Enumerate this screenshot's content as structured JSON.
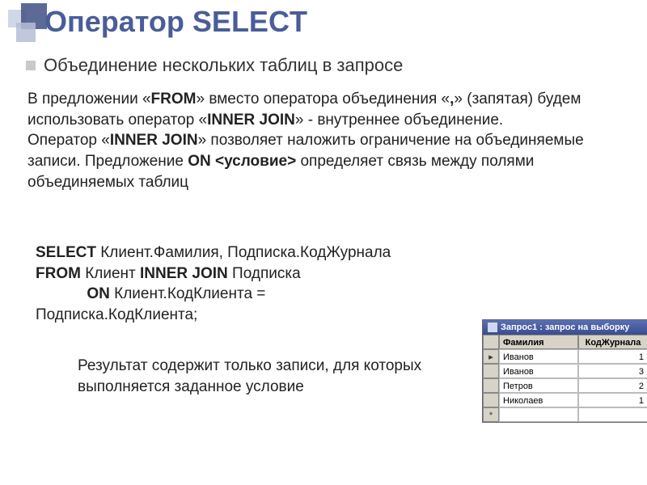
{
  "title": "Оператор SELECT",
  "subtitle": "Объединение нескольких таблиц в запросе",
  "para": {
    "p1a": "В предложении «",
    "from": "FROM",
    "p1b": "» вместо оператора объединения «",
    "comma": ",",
    "p1c": "» (запятая) будем использовать оператор «",
    "ij1": "INNER JOIN",
    "p1d": "» - внутреннее объединение.",
    "p2a": "Оператор «",
    "ij2": "INNER JOIN",
    "p2b": "» позволяет наложить ограничение на объединяемые записи. Предложение ",
    "on": "ON <условие>",
    "p2c": " определяет связь между полями объединяемых таблиц"
  },
  "sql": {
    "kw_select": "SELECT",
    "sel_fields": " Клиент.Фамилия, Подписка.КодЖурнала",
    "kw_from": "FROM",
    "tbl1": " Клиент ",
    "kw_ij": "INNER JOIN",
    "tbl2": " Подписка",
    "on_indent": "            ",
    "kw_on": "ON",
    "on_expr1": " Клиент.КодКлиента =",
    "on_expr2": "Подписка.КодКлиента;"
  },
  "result_note": "Результат содержит только записи, для которых выполняется заданное условие",
  "access": {
    "title": "Запрос1 : запрос на выборку",
    "col_a": "Фамилия",
    "col_b": "КодЖурнала",
    "rows": [
      {
        "name": "Иванов",
        "code": "1"
      },
      {
        "name": "Иванов",
        "code": "3"
      },
      {
        "name": "Петров",
        "code": "2"
      },
      {
        "name": "Николаев",
        "code": "1"
      }
    ],
    "current_marker": "▸",
    "new_marker": "*"
  }
}
